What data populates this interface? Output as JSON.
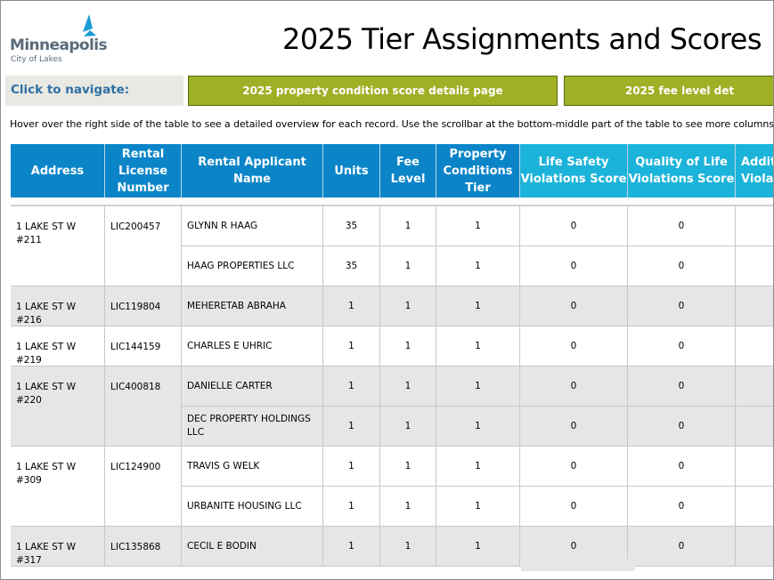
{
  "title": "2025 Tier Assignments and Scores",
  "logo": {
    "name": "Minneapolis",
    "tagline": "City of Lakes"
  },
  "nav": {
    "label": "Click to navigate:",
    "buttons": [
      "2025 property condition score details page",
      "2025 fee level det"
    ]
  },
  "hint": "Hover over the right side of the table to see a detailed overview for each record. Use the scrollbar at the bottom-middle part of the table to see more columns.",
  "colors": {
    "header_blue": "#0b85c8",
    "header_cyan": "#1bb3d9",
    "nav_green": "#9fb026",
    "label_blue": "#2e6fa3",
    "row_gray": "#e6e6e6"
  },
  "table": {
    "headers": [
      "Address",
      "Rental License Number",
      "Rental Applicant Name",
      "Units",
      "Fee Level",
      "Property Conditions Tier",
      "Life Safety Violations Score",
      "Quality of Life Violations Score",
      "Additi Violati"
    ],
    "groups": [
      {
        "address": "1 LAKE ST W #211",
        "license": "LIC200457",
        "shaded": false,
        "rows": [
          {
            "name": "GLYNN R HAAG",
            "units": "35",
            "fee": "1",
            "tier": "1",
            "life": "0",
            "qol": "0"
          },
          {
            "name": "HAAG PROPERTIES LLC",
            "units": "35",
            "fee": "1",
            "tier": "1",
            "life": "0",
            "qol": "0"
          }
        ]
      },
      {
        "address": "1 LAKE ST W #216",
        "license": "LIC119804",
        "shaded": true,
        "rows": [
          {
            "name": "MEHERETAB  ABRAHA",
            "units": "1",
            "fee": "1",
            "tier": "1",
            "life": "0",
            "qol": "0"
          }
        ]
      },
      {
        "address": "1 LAKE ST W #219",
        "license": "LIC144159",
        "shaded": false,
        "rows": [
          {
            "name": "CHARLES E UHRIC",
            "units": "1",
            "fee": "1",
            "tier": "1",
            "life": "0",
            "qol": "0"
          }
        ]
      },
      {
        "address": "1 LAKE ST W #220",
        "license": "LIC400818",
        "shaded": true,
        "rows": [
          {
            "name": "DANIELLE CARTER",
            "units": "1",
            "fee": "1",
            "tier": "1",
            "life": "0",
            "qol": "0"
          },
          {
            "name": "DEC PROPERTY HOLDINGS LLC",
            "units": "1",
            "fee": "1",
            "tier": "1",
            "life": "0",
            "qol": "0"
          }
        ]
      },
      {
        "address": "1 LAKE ST W #309",
        "license": "LIC124900",
        "shaded": false,
        "rows": [
          {
            "name": "TRAVIS G WELK",
            "units": "1",
            "fee": "1",
            "tier": "1",
            "life": "0",
            "qol": "0"
          },
          {
            "name": "URBANITE HOUSING LLC",
            "units": "1",
            "fee": "1",
            "tier": "1",
            "life": "0",
            "qol": "0"
          }
        ]
      },
      {
        "address": "1 LAKE ST W #317",
        "license": "LIC135868",
        "shaded": true,
        "rows": [
          {
            "name": "CECIL E BODIN",
            "units": "1",
            "fee": "1",
            "tier": "1",
            "life": "0",
            "qol": "0"
          }
        ]
      }
    ]
  }
}
